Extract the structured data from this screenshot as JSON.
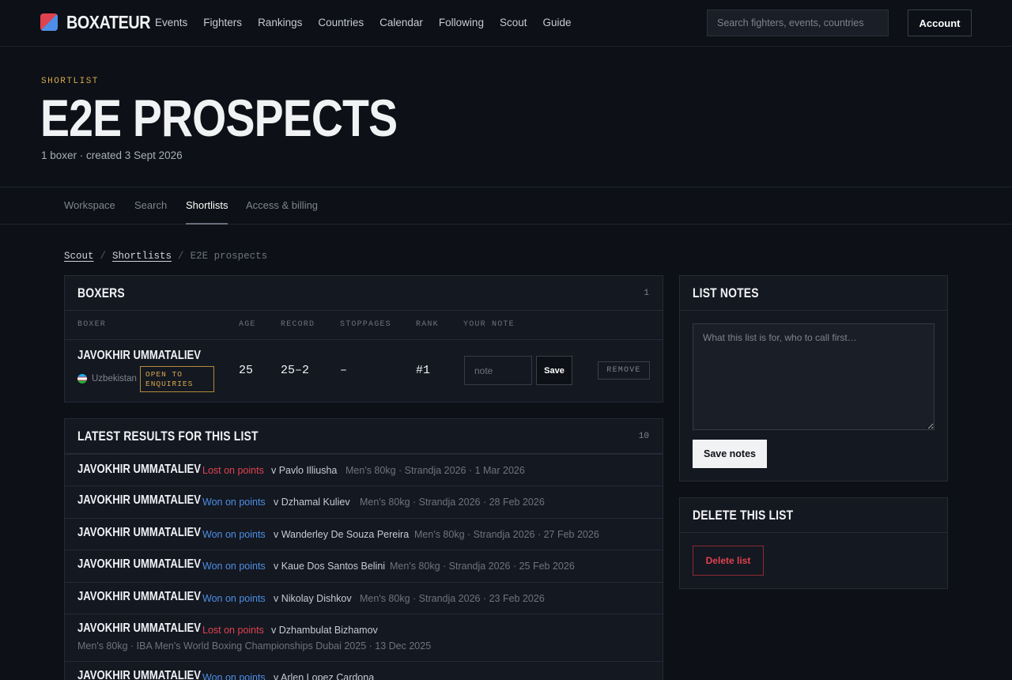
{
  "nav": {
    "brand": "BOXATEUR",
    "links": [
      "Events",
      "Fighters",
      "Rankings",
      "Countries",
      "Calendar",
      "Following",
      "Scout",
      "Guide"
    ],
    "search_placeholder": "Search fighters, events, countries",
    "account_label": "Account"
  },
  "hero": {
    "eyebrow": "SHORTLIST",
    "title": "E2E PROSPECTS",
    "subtitle": "1 boxer · created 3 Sept 2026"
  },
  "tabs": {
    "items": [
      "Workspace",
      "Search",
      "Shortlists",
      "Access & billing"
    ],
    "active": "Shortlists"
  },
  "breadcrumb": {
    "scout": "Scout",
    "shortlists": "Shortlists",
    "current": "E2E prospects",
    "sep": "/"
  },
  "boxers_panel": {
    "title": "BOXERS",
    "count": "1",
    "columns": [
      "BOXER",
      "AGE",
      "RECORD",
      "STOPPAGES",
      "RANK",
      "YOUR NOTE"
    ],
    "rows": [
      {
        "name": "JAVOKHIR UMMATALIEV",
        "country": "Uzbekistan",
        "badge": "OPEN TO ENQUIRIES",
        "age": "25",
        "record": "25–2",
        "stoppages": "–",
        "rank": "#1",
        "note_placeholder": "note",
        "save_label": "Save",
        "remove_label": "REMOVE"
      }
    ]
  },
  "results_panel": {
    "title": "LATEST RESULTS FOR THIS LIST",
    "count": "10",
    "rows": [
      {
        "name": "JAVOKHIR UMMATALIEV",
        "result": "Lost on points",
        "outcome": "lost",
        "opponent": "v Pavlo Illiusha",
        "meta": "Men's 80kg · Strandja 2026 · 1 Mar 2026"
      },
      {
        "name": "JAVOKHIR UMMATALIEV",
        "result": "Won on points",
        "outcome": "won",
        "opponent": "v Dzhamal Kuliev",
        "meta": "Men's 80kg · Strandja 2026 · 28 Feb 2026"
      },
      {
        "name": "JAVOKHIR UMMATALIEV",
        "result": "Won on points",
        "outcome": "won",
        "opponent": "v Wanderley De Souza Pereira",
        "meta": "Men's 80kg · Strandja 2026 · 27 Feb 2026"
      },
      {
        "name": "JAVOKHIR UMMATALIEV",
        "result": "Won on points",
        "outcome": "won",
        "opponent": "v Kaue Dos Santos Belini",
        "meta": "Men's 80kg · Strandja 2026 · 25 Feb 2026"
      },
      {
        "name": "JAVOKHIR UMMATALIEV",
        "result": "Won on points",
        "outcome": "won",
        "opponent": "v Nikolay Dishkov",
        "meta": "Men's 80kg · Strandja 2026 · 23 Feb 2026"
      },
      {
        "name": "JAVOKHIR UMMATALIEV",
        "result": "Lost on points",
        "outcome": "lost",
        "opponent": "v Dzhambulat Bizhamov",
        "meta": "Men's 80kg · IBA Men's World Boxing Championships Dubai 2025 · 13 Dec 2025"
      },
      {
        "name": "JAVOKHIR UMMATALIEV",
        "result": "Won on points",
        "outcome": "won",
        "opponent": "v Arlen Lopez Cardona",
        "meta": ""
      }
    ]
  },
  "notes_panel": {
    "title": "LIST NOTES",
    "placeholder": "What this list is for, who to call first…",
    "save_label": "Save notes"
  },
  "delete_panel": {
    "title": "DELETE THIS LIST",
    "button_label": "Delete list"
  },
  "colors": {
    "background": "#0d1016",
    "panel": "#141821",
    "accent_gold": "#d6a84f",
    "lost_red": "#e0424f",
    "won_blue": "#4d8fe6"
  }
}
